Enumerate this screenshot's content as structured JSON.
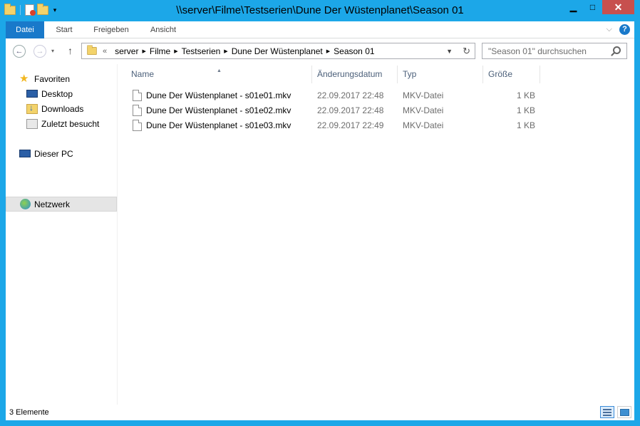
{
  "window": {
    "title": "\\\\server\\Filme\\Testserien\\Dune Der Wüstenplanet\\Season 01",
    "minimize": "▁",
    "maximize": "□",
    "close": "✕"
  },
  "ribbon": {
    "tabs": [
      {
        "label": "Datei"
      },
      {
        "label": "Start"
      },
      {
        "label": "Freigeben"
      },
      {
        "label": "Ansicht"
      }
    ],
    "help": "?"
  },
  "nav": {
    "address_prefix": "«",
    "breadcrumbs": [
      "server",
      "Filme",
      "Testserien",
      "Dune Der Wüstenplanet",
      "Season 01"
    ],
    "search_placeholder": "\"Season 01\" durchsuchen"
  },
  "sidebar": {
    "favorites": {
      "label": "Favoriten",
      "icon": "star-icon"
    },
    "favorite_items": [
      {
        "label": "Desktop",
        "icon": "desktop-icon"
      },
      {
        "label": "Downloads",
        "icon": "downloads-icon"
      },
      {
        "label": "Zuletzt besucht",
        "icon": "recent-places-icon"
      }
    ],
    "this_pc": {
      "label": "Dieser PC",
      "icon": "computer-icon"
    },
    "network": {
      "label": "Netzwerk",
      "icon": "network-icon",
      "selected": true
    }
  },
  "list": {
    "columns": {
      "name": "Name",
      "date": "Änderungsdatum",
      "type": "Typ",
      "size": "Größe"
    },
    "rows": [
      {
        "name": "Dune Der Wüstenplanet - s01e01.mkv",
        "date": "22.09.2017 22:48",
        "type": "MKV-Datei",
        "size": "1 KB"
      },
      {
        "name": "Dune Der Wüstenplanet - s01e02.mkv",
        "date": "22.09.2017 22:48",
        "type": "MKV-Datei",
        "size": "1 KB"
      },
      {
        "name": "Dune Der Wüstenplanet - s01e03.mkv",
        "date": "22.09.2017 22:49",
        "type": "MKV-Datei",
        "size": "1 KB"
      }
    ]
  },
  "status": {
    "item_count": "3 Elemente"
  },
  "colors": {
    "frame": "#1ca7e8",
    "file_tab": "#1979ca",
    "close_button": "#c7504e"
  }
}
